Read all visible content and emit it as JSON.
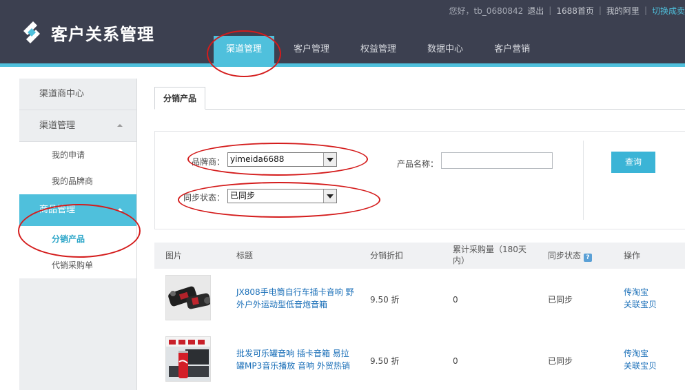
{
  "header": {
    "app_title": "客户关系管理",
    "greeting": "您好，tb_0680842",
    "logout": "退出",
    "home_link": "1688首页",
    "my_alibaba": "我的阿里",
    "switch_link": "切换成卖",
    "nav": [
      {
        "label": "渠道管理",
        "active": true
      },
      {
        "label": "客户管理",
        "active": false
      },
      {
        "label": "权益管理",
        "active": false
      },
      {
        "label": "数据中心",
        "active": false
      },
      {
        "label": "客户营销",
        "active": false
      }
    ]
  },
  "sidebar": {
    "channel_center": "渠道商中心",
    "channel_mgmt": "渠道管理",
    "my_applications": "我的申请",
    "my_brands": "我的品牌商",
    "product_mgmt": "商品管理",
    "distribution_products": "分销产品",
    "consignment_orders": "代销采购单"
  },
  "tab": {
    "label": "分销产品"
  },
  "filters": {
    "brand_label": "品牌商：",
    "brand_value": "yimeida6688",
    "sync_label": "同步状态：",
    "sync_value": "已同步",
    "product_name_label": "产品名称：",
    "product_name_value": "",
    "query_button": "查询"
  },
  "table": {
    "headers": {
      "image": "图片",
      "title": "标题",
      "discount": "分销折扣",
      "purchase_qty": "累计采购量（180天内）",
      "sync_status": "同步状态",
      "actions": "操作"
    },
    "rows": [
      {
        "title": "JX808手电筒自行车插卡音响 野外户外运动型低音炮音箱",
        "discount": "9.50 折",
        "purchase_qty": "0",
        "sync_status": "已同步",
        "action_1": "传淘宝",
        "action_2": "关联宝贝"
      },
      {
        "title": "批发可乐罐音响 插卡音箱 易拉罐MP3音乐播放 音响 外贸热销",
        "discount": "9.50 折",
        "purchase_qty": "0",
        "sync_status": "已同步",
        "action_1": "传淘宝",
        "action_2": "关联宝贝"
      }
    ]
  },
  "colors": {
    "header_bg": "#3c4050",
    "accent": "#4fc0dc",
    "annotation_red": "#d41c1c",
    "link_blue": "#1a6fb8"
  }
}
